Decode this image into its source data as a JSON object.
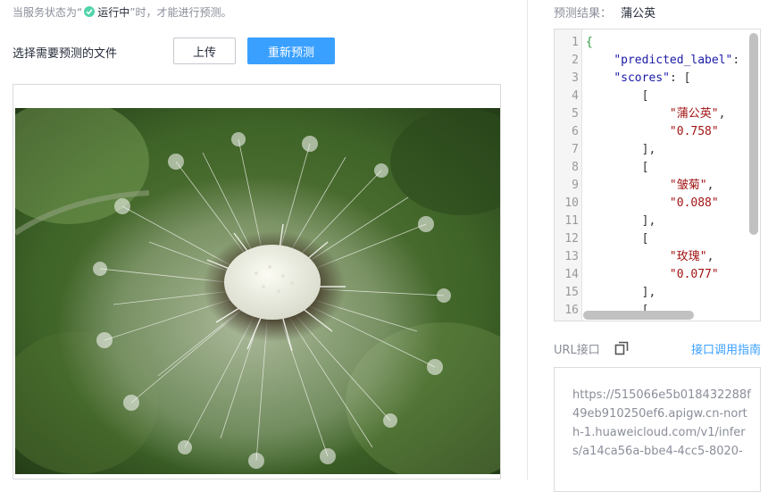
{
  "status": {
    "prefix": "当服务状态为“",
    "running": "运行中",
    "suffix": "”时，才能进行预测。"
  },
  "upload": {
    "file_label": "选择需要预测的文件",
    "upload_button": "上传",
    "repredict_button": "重新预测"
  },
  "result": {
    "label": "预测结果：",
    "value": "蒲公英",
    "code_lines": [
      {
        "n": "1",
        "tokens": [
          {
            "t": "{",
            "c": "brace"
          }
        ]
      },
      {
        "n": "2",
        "tokens": [
          {
            "t": "    ",
            "c": "punc"
          },
          {
            "t": "\"predicted_label\"",
            "c": "key"
          },
          {
            "t": ":",
            "c": "punc"
          }
        ]
      },
      {
        "n": "3",
        "tokens": [
          {
            "t": "    ",
            "c": "punc"
          },
          {
            "t": "\"scores\"",
            "c": "key"
          },
          {
            "t": ": [",
            "c": "punc"
          }
        ]
      },
      {
        "n": "4",
        "tokens": [
          {
            "t": "        [",
            "c": "punc"
          }
        ]
      },
      {
        "n": "5",
        "tokens": [
          {
            "t": "            ",
            "c": "punc"
          },
          {
            "t": "\"蒲公英\"",
            "c": "str"
          },
          {
            "t": ",",
            "c": "punc"
          }
        ]
      },
      {
        "n": "6",
        "tokens": [
          {
            "t": "            ",
            "c": "punc"
          },
          {
            "t": "\"0.758\"",
            "c": "str"
          }
        ]
      },
      {
        "n": "7",
        "tokens": [
          {
            "t": "        ],",
            "c": "punc"
          }
        ]
      },
      {
        "n": "8",
        "tokens": [
          {
            "t": "        [",
            "c": "punc"
          }
        ]
      },
      {
        "n": "9",
        "tokens": [
          {
            "t": "            ",
            "c": "punc"
          },
          {
            "t": "\"皱菊\"",
            "c": "str"
          },
          {
            "t": ",",
            "c": "punc"
          }
        ]
      },
      {
        "n": "10",
        "tokens": [
          {
            "t": "            ",
            "c": "punc"
          },
          {
            "t": "\"0.088\"",
            "c": "str"
          }
        ]
      },
      {
        "n": "11",
        "tokens": [
          {
            "t": "        ],",
            "c": "punc"
          }
        ]
      },
      {
        "n": "12",
        "tokens": [
          {
            "t": "        [",
            "c": "punc"
          }
        ]
      },
      {
        "n": "13",
        "tokens": [
          {
            "t": "            ",
            "c": "punc"
          },
          {
            "t": "\"玫瑰\"",
            "c": "str"
          },
          {
            "t": ",",
            "c": "punc"
          }
        ]
      },
      {
        "n": "14",
        "tokens": [
          {
            "t": "            ",
            "c": "punc"
          },
          {
            "t": "\"0.077\"",
            "c": "str"
          }
        ]
      },
      {
        "n": "15",
        "tokens": [
          {
            "t": "        ],",
            "c": "punc"
          }
        ]
      },
      {
        "n": "16",
        "tokens": [
          {
            "t": "        [",
            "c": "punc"
          }
        ]
      }
    ]
  },
  "url": {
    "label": "URL接口",
    "guide_link": "接口调用指南",
    "value": "https://515066e5b018432288f49eb910250ef6.apigw.cn-north-1.huaweicloud.com/v1/infers/a14ca56a-bbe4-4cc5-8020-"
  },
  "icons": {
    "status": "check-circle-icon",
    "copy": "copy-icon"
  },
  "colors": {
    "primary": "#3aa0ff",
    "status_ok": "#50d4ab",
    "muted_text": "#8a8e99"
  }
}
